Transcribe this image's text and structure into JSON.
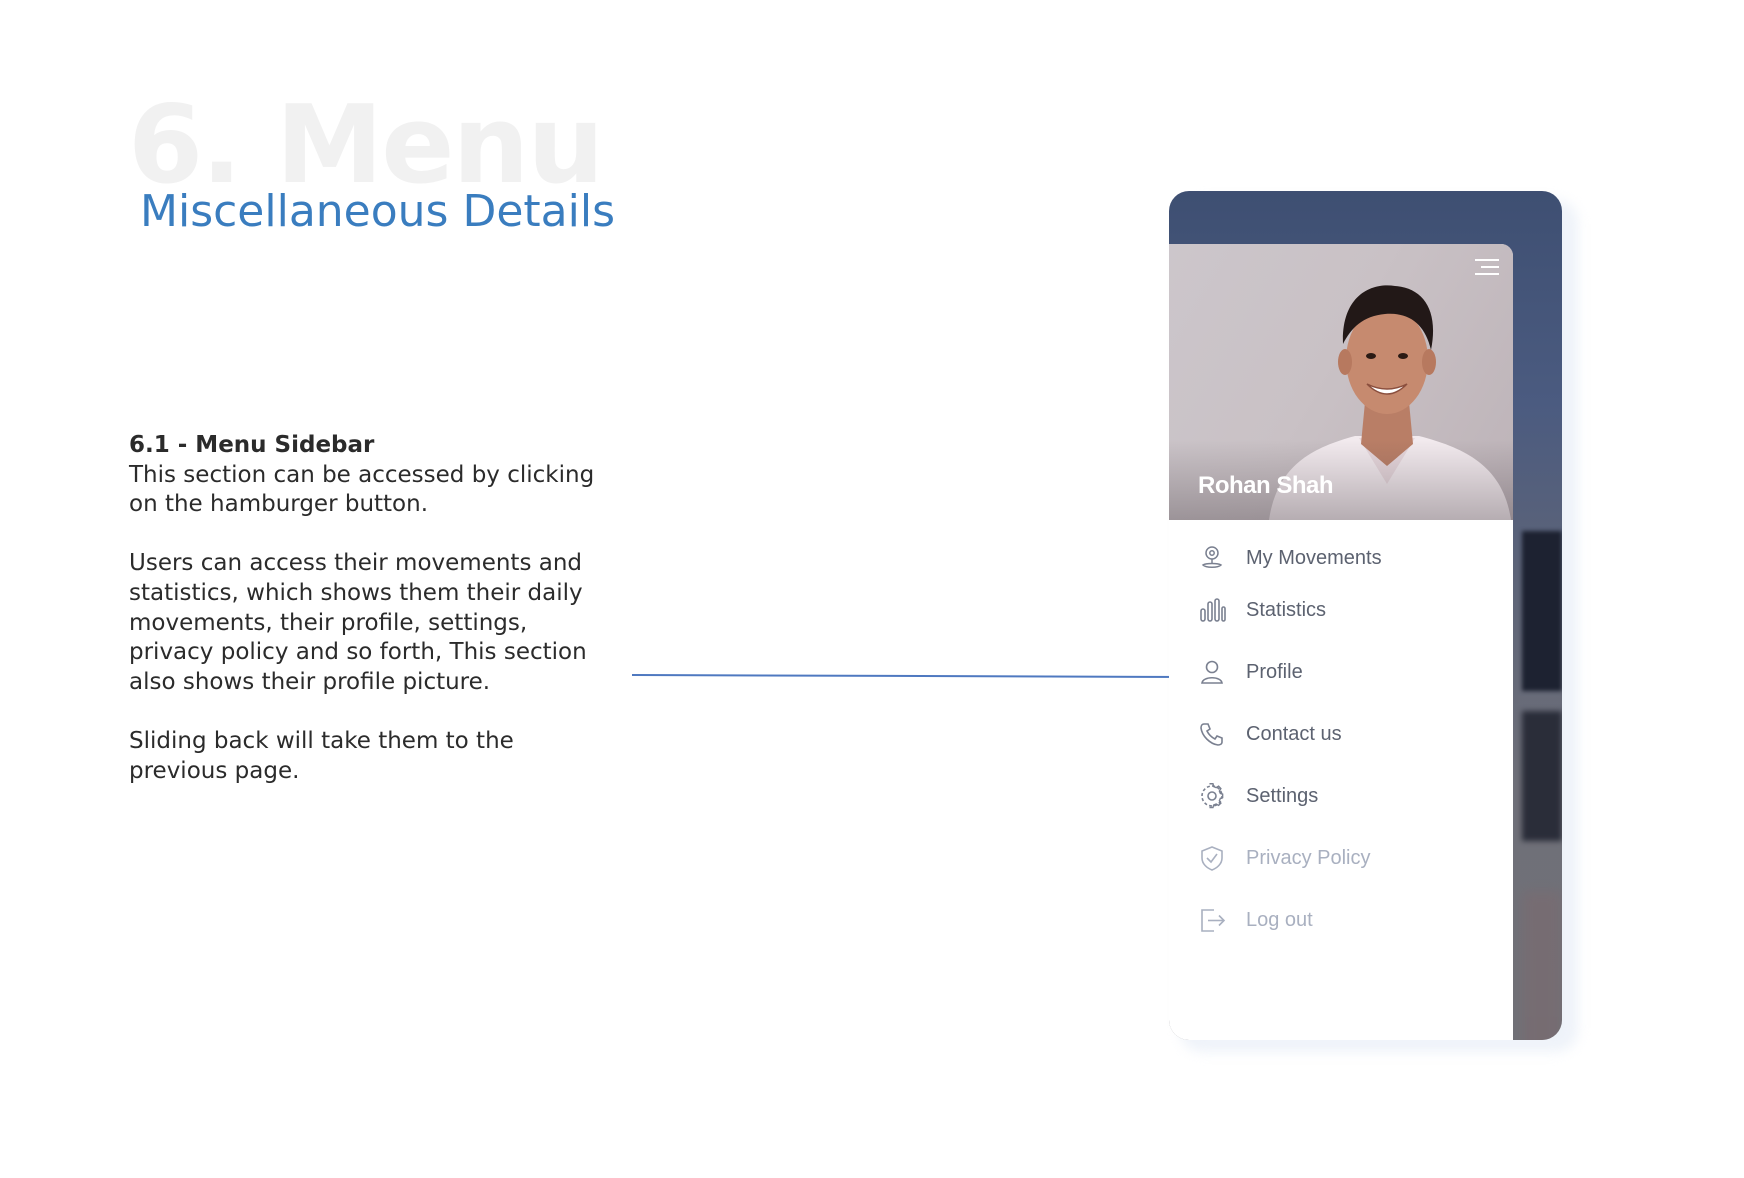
{
  "page": {
    "bg_title": "6. Menu",
    "subtitle": "Miscellaneous Details",
    "section_heading": "6.1 - Menu Sidebar",
    "paragraphs": [
      "This section can be accessed by clicking on the hamburger button.",
      "Users can access their movements and statistics, which shows them their daily movements, their profile, settings, privacy policy and so forth, This section also shows their profile picture.",
      "Sliding back will take them to the previous page."
    ]
  },
  "drawer": {
    "user_name": "Rohan Shah",
    "items": [
      {
        "label": "My Movements",
        "icon": "location-pin-icon"
      },
      {
        "label": "Statistics",
        "icon": "bar-chart-icon"
      },
      {
        "label": "Profile",
        "icon": "user-icon"
      },
      {
        "label": "Contact us",
        "icon": "phone-icon"
      },
      {
        "label": "Settings",
        "icon": "gear-icon"
      },
      {
        "label": "Privacy Policy",
        "icon": "shield-check-icon"
      },
      {
        "label": "Log out",
        "icon": "logout-icon"
      }
    ]
  },
  "colors": {
    "accent": "#3a7dbf",
    "connector": "#4f79c0",
    "menu_text": "#5c6270",
    "menu_text_faded": "#a9b0c0"
  }
}
